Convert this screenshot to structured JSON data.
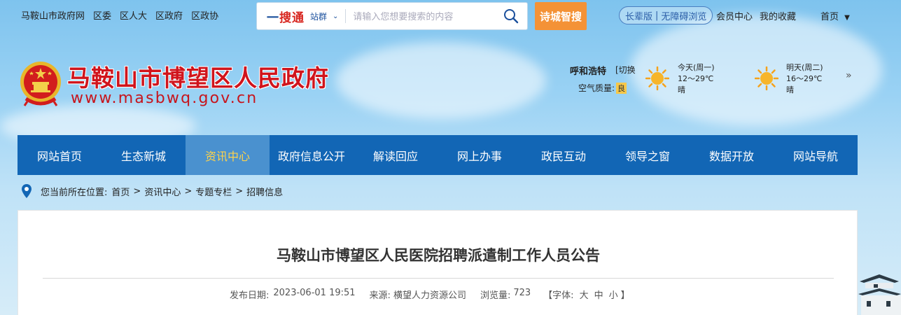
{
  "top": {
    "links": [
      "马鞍山市政府网",
      "区委",
      "区人大",
      "区政府",
      "区政协"
    ],
    "search": {
      "logo_prefix": "一",
      "logo_main": "搜通",
      "scope": "站群",
      "placeholder": "请输入您想要搜索的内容"
    },
    "poetry_button": "诗城智搜",
    "access": {
      "elder": "长辈版",
      "barrier_free": "无障碍浏览"
    },
    "user_links": [
      "会员中心",
      "我的收藏"
    ],
    "homepage": "首页"
  },
  "header": {
    "title": "马鞍山市博望区人民政府",
    "url": "www.masbwq.gov.cn"
  },
  "weather": {
    "city": "呼和浩特",
    "switch": "[切换",
    "air_label": "空气质量:",
    "air_value": "良",
    "today": {
      "day": "今天(周一)",
      "temp": "12～29℃",
      "cond": "晴"
    },
    "tomorrow": {
      "day": "明天(周二)",
      "temp": "16～29℃",
      "cond": "晴"
    }
  },
  "nav": {
    "items": [
      "网站首页",
      "生态新城",
      "资讯中心",
      "政府信息公开",
      "解读回应",
      "网上办事",
      "政民互动",
      "领导之窗",
      "数据开放",
      "网站导航"
    ],
    "active_index": 2
  },
  "breadcrumb": {
    "label": "您当前所在位置:",
    "items": [
      "首页",
      "资讯中心",
      "专题专栏",
      "招聘信息"
    ],
    "separator": ">"
  },
  "article": {
    "title": "马鞍山市博望区人民医院招聘派遣制工作人员公告",
    "date_label": "发布日期:",
    "date": "2023-06-01 19:51",
    "source_label": "来源:",
    "source": "横望人力资源公司",
    "views_label": "浏览量:",
    "views": "723",
    "font_label": "【字体:",
    "font_large": "大",
    "font_medium": "中",
    "font_small": "小",
    "font_close": "】"
  },
  "colors": {
    "nav": "#1266b5",
    "nav_active": "#4a91cf",
    "nav_active_text": "#ffd34a",
    "title_red": "#d0141c",
    "poetry": "#f49236"
  }
}
